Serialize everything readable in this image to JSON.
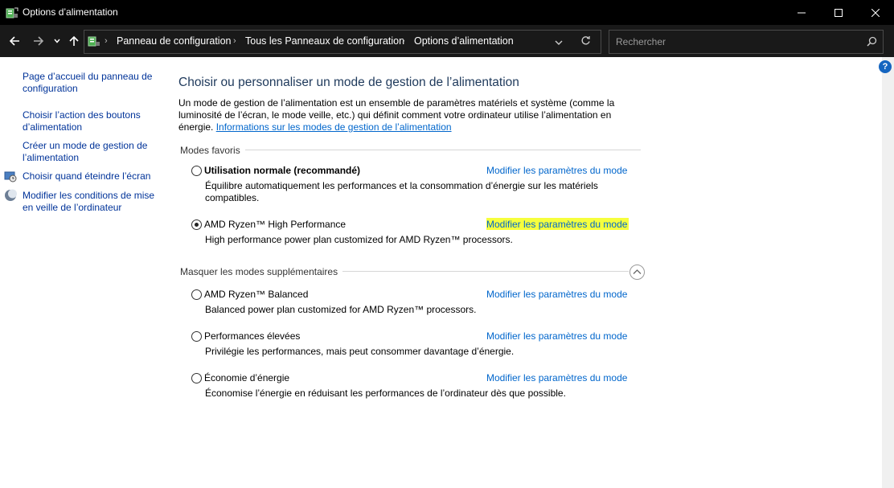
{
  "window": {
    "title": "Options d’alimentation"
  },
  "address": {
    "crumbs": [
      "Panneau de configuration",
      "Tous les Panneaux de configuration",
      "Options d’alimentation"
    ]
  },
  "search": {
    "placeholder": "Rechercher"
  },
  "sidebar": {
    "items": [
      {
        "label": "Page d’accueil du panneau de configuration"
      },
      {
        "label": "Choisir l’action des boutons d’alimentation"
      },
      {
        "label": "Créer un mode de gestion de l’alimentation"
      },
      {
        "label": "Choisir quand éteindre l’écran",
        "icon": "monitor-clock-icon"
      },
      {
        "label": "Modifier les conditions de mise en veille de l’ordinateur",
        "icon": "moon-icon"
      }
    ]
  },
  "main": {
    "heading": "Choisir ou personnaliser un mode de gestion de l’alimentation",
    "description": "Un mode de gestion de l’alimentation est un ensemble de paramètres matériels et système (comme la luminosité de l’écran, le mode veille, etc.) qui définit comment votre ordinateur utilise l’alimentation en énergie.",
    "info_link": "Informations sur les modes de gestion de l’alimentation",
    "favorites_label": "Modes favoris",
    "extra_label": "Masquer les modes supplémentaires",
    "change_link": "Modifier les paramètres du mode",
    "plans": [
      {
        "name": "Utilisation normale (recommandé)",
        "desc": "Équilibre automatiquement les performances et la consommation d’énergie sur les matériels compatibles.",
        "selected": false
      },
      {
        "name": "AMD Ryzen™ High Performance",
        "desc": "High performance power plan customized for AMD Ryzen™ processors.",
        "selected": true
      },
      {
        "name": "AMD Ryzen™ Balanced",
        "desc": "Balanced power plan customized for AMD Ryzen™ processors.",
        "selected": false
      },
      {
        "name": "Performances élevées",
        "desc": "Privilégie les performances, mais peut consommer davantage d’énergie.",
        "selected": false
      },
      {
        "name": "Économie d’énergie",
        "desc": "Économise l’énergie en réduisant les performances de l’ordinateur dès que possible.",
        "selected": false
      }
    ]
  },
  "colors": {
    "link": "#0066cc",
    "heading": "#1e395b",
    "highlight": "#f6ff3d",
    "titlebar": "#000000"
  }
}
